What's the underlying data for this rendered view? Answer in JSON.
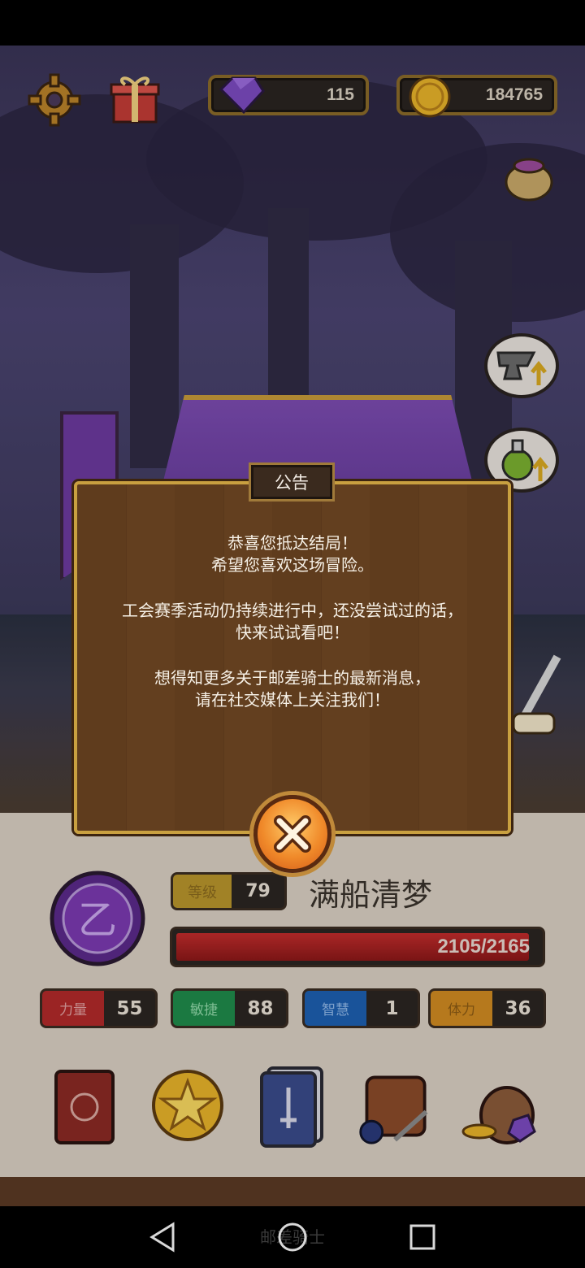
{
  "currency": {
    "gems": "115",
    "coins": "184765"
  },
  "dialog": {
    "title": "公告",
    "paragraph1_line1": "恭喜您抵达结局！",
    "paragraph1_line2": "希望您喜欢这场冒险。",
    "paragraph2_line1": "工会赛季活动仍持续进行中，还没尝试过的话，",
    "paragraph2_line2": "快来试试看吧！",
    "paragraph3_line1": "想得知更多关于邮差骑士的最新消息，",
    "paragraph3_line2": "请在社交媒体上关注我们！"
  },
  "player": {
    "level_label": "等级",
    "level": "79",
    "name": "满船清梦",
    "hp_text": "2105/2165",
    "hp_fraction": 0.972
  },
  "stats": [
    {
      "label": "力量",
      "value": "55"
    },
    {
      "label": "敏捷",
      "value": "88"
    },
    {
      "label": "智慧",
      "value": "1"
    },
    {
      "label": "体力",
      "value": "36"
    }
  ],
  "nav": {
    "watermark": "邮差骑士"
  },
  "icons": {
    "settings": "gear-icon",
    "gift": "gift-box-icon",
    "gem": "purple-gem-icon",
    "coin": "gold-coin-icon",
    "pot": "potion-pot-icon",
    "anvil_upgrade": "anvil-upgrade-icon",
    "potion_upgrade": "potion-upgrade-icon",
    "sword": "sword-scroll-icon",
    "avatar": "guild-emblem-icon",
    "menu": [
      "spellbook-icon",
      "star-coin-icon",
      "card-deck-icon",
      "backpack-icon",
      "treasure-bag-icon"
    ],
    "close": "close-x-icon"
  },
  "colors": {
    "dialog_border": "#c9a040",
    "dialog_bg": "#5f3c1d",
    "hp_red": "#c22c2c",
    "strength": "#b12a2a",
    "agility": "#1f8a4a",
    "wisdom": "#1d5fb0",
    "stamina": "#d08a22"
  }
}
